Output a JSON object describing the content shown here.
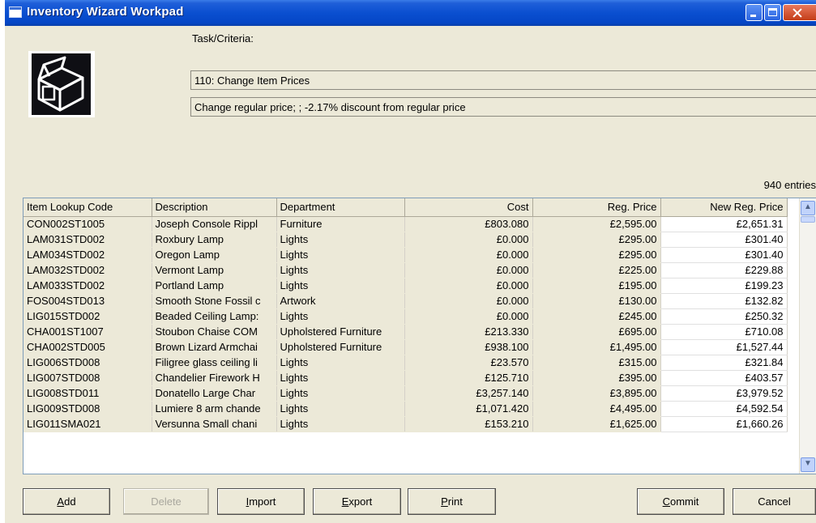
{
  "window": {
    "title": "Inventory Wizard Workpad"
  },
  "criteria": {
    "label": "Task/Criteria:",
    "task": "110: Change Item Prices",
    "description": "Change regular price; ; -2.17% discount from regular price"
  },
  "grid": {
    "entries_count": "940 entries",
    "columns": [
      "Item Lookup Code",
      "Description",
      "Department",
      "Cost",
      "Reg. Price",
      "New Reg. Price"
    ],
    "rows": [
      [
        "CON002ST1005",
        "Joseph Console Rippl",
        "Furniture",
        "£803.080",
        "£2,595.00",
        "£2,651.31"
      ],
      [
        "LAM031STD002",
        "Roxbury Lamp",
        "Lights",
        "£0.000",
        "£295.00",
        "£301.40"
      ],
      [
        "LAM034STD002",
        "Oregon Lamp",
        "Lights",
        "£0.000",
        "£295.00",
        "£301.40"
      ],
      [
        "LAM032STD002",
        "Vermont Lamp",
        "Lights",
        "£0.000",
        "£225.00",
        "£229.88"
      ],
      [
        "LAM033STD002",
        "Portland Lamp",
        "Lights",
        "£0.000",
        "£195.00",
        "£199.23"
      ],
      [
        "FOS004STD013",
        "Smooth Stone Fossil c",
        "Artwork",
        "£0.000",
        "£130.00",
        "£132.82"
      ],
      [
        "LIG015STD002",
        "Beaded Ceiling Lamp:",
        "Lights",
        "£0.000",
        "£245.00",
        "£250.32"
      ],
      [
        "CHA001ST1007",
        "Stoubon Chaise COM",
        "Upholstered Furniture",
        "£213.330",
        "£695.00",
        "£710.08"
      ],
      [
        "CHA002STD005",
        "Brown Lizard Armchai",
        "Upholstered Furniture",
        "£938.100",
        "£1,495.00",
        "£1,527.44"
      ],
      [
        "LIG006STD008",
        "Filigree glass ceiling li",
        "Lights",
        "£23.570",
        "£315.00",
        "£321.84"
      ],
      [
        "LIG007STD008",
        "Chandelier Firework H",
        "Lights",
        "£125.710",
        "£395.00",
        "£403.57"
      ],
      [
        "LIG008STD011",
        "Donatello Large Char",
        "Lights",
        "£3,257.140",
        "£3,895.00",
        "£3,979.52"
      ],
      [
        "LIG009STD008",
        "Lumiere 8 arm chande",
        "Lights",
        "£1,071.420",
        "£4,495.00",
        "£4,592.54"
      ],
      [
        "LIG011SMA021",
        "Versunna Small chani",
        "Lights",
        "£153.210",
        "£1,625.00",
        "£1,660.26"
      ]
    ]
  },
  "buttons": {
    "add": {
      "mnemonic": "A",
      "rest": "dd"
    },
    "delete": "Delete",
    "import": {
      "mnemonic": "I",
      "rest": "mport"
    },
    "export": {
      "mnemonic": "E",
      "rest": "xport"
    },
    "print": {
      "mnemonic": "P",
      "rest": "rint"
    },
    "commit": {
      "mnemonic": "C",
      "rest": "ommit"
    },
    "cancel": "Cancel"
  }
}
